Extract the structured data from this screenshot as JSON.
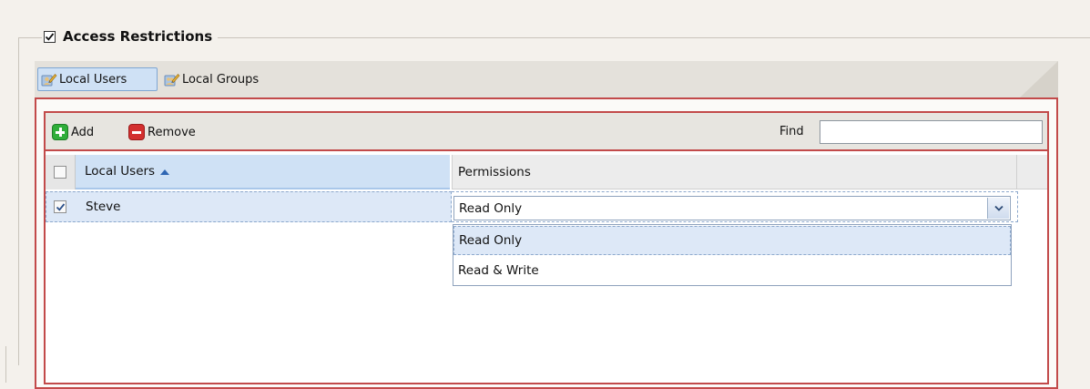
{
  "section": {
    "title": "Access Restrictions",
    "enabled": true
  },
  "tabs": [
    {
      "label": "Local Users",
      "active": true,
      "icon": "users-pencil-icon"
    },
    {
      "label": "Local Groups",
      "active": false,
      "icon": "groups-pencil-icon"
    }
  ],
  "toolbar": {
    "add_label": "Add",
    "remove_label": "Remove",
    "find_label": "Find",
    "find_value": ""
  },
  "grid": {
    "columns": [
      "Local Users",
      "Permissions"
    ],
    "sort_column": "Local Users",
    "sort_direction": "ascending",
    "rows": [
      {
        "checked": true,
        "user": "Steve",
        "permission": "Read Only"
      }
    ]
  },
  "dropdown": {
    "options": [
      "Read Only",
      "Read & Write"
    ],
    "selected": "Read Only"
  },
  "colors": {
    "accent_red": "#c24a4a",
    "selection_blue": "#dde8f7",
    "add_green": "#2fae3a",
    "remove_red": "#d32f2f"
  }
}
